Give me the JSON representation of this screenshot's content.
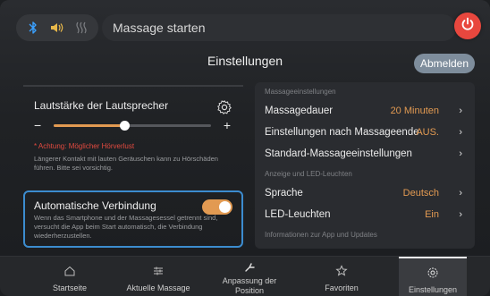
{
  "topbar": {
    "icons": [
      "bluetooth-icon",
      "speaker-icon",
      "heat-icon"
    ],
    "massage_label": "Massage starten",
    "power_icon": "power-icon"
  },
  "header": {
    "title": "Einstellungen",
    "logout_label": "Abmelden"
  },
  "speaker": {
    "title": "Lautstärke der Lautsprecher",
    "minus": "−",
    "plus": "+",
    "volume_fraction": 0.45,
    "warning_title": "* Achtung: Möglicher Hörverlust",
    "warning_text": "Längerer Kontakt mit lauten Geräuschen kann zu Hörschäden führen. Bitte sei vorsichtig."
  },
  "auto_connect": {
    "title": "Automatische Verbindung",
    "enabled": true,
    "description": "Wenn das Smartphone und der Massagesessel getrennt sind, versucht die App beim Start automatisch, die Verbindung wiederherzustellen."
  },
  "settings": {
    "section_massage": "Massageeinstellungen",
    "massage_duration_label": "Massagedauer",
    "massage_duration_value": "20 Minuten",
    "after_massage_label": "Einstellungen nach Massageende",
    "after_massage_value": "AUS.",
    "standard_label": "Standard-Massageeinstellungen",
    "section_display": "Anzeige und LED-Leuchten",
    "language_label": "Sprache",
    "language_value": "Deutsch",
    "led_label": "LED-Leuchten",
    "led_value": "Ein",
    "section_info": "Informationen zur App und Updates"
  },
  "nav": {
    "home": "Startseite",
    "current": "Aktuelle Massage",
    "position": "Anpassung der Position",
    "favorites": "Favoriten",
    "settings": "Einstellungen",
    "active": "settings"
  },
  "colors": {
    "accent": "#e29a52",
    "power": "#e8473e",
    "focus_border": "#3c8ccf",
    "warning": "#e34a3f"
  }
}
